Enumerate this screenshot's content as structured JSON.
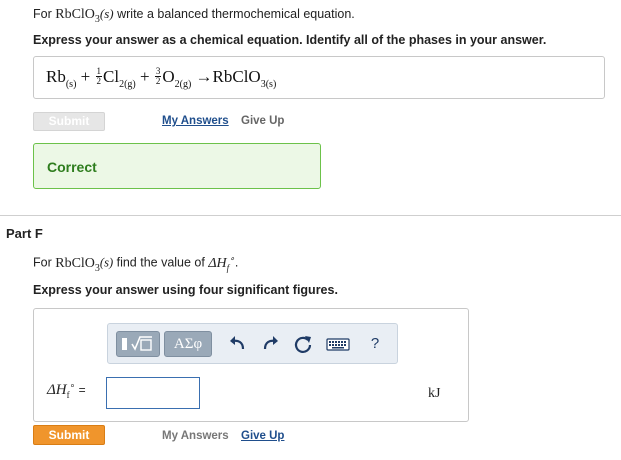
{
  "part_e": {
    "question_prefix": "For ",
    "compound": "RbClO",
    "compound_sub": "3",
    "phase": "(s)",
    "question_suffix": " write a balanced thermochemical equation.",
    "instructions": "Express your answer as a chemical equation. Identify all of the phases in your answer.",
    "equation": {
      "t1": "Rb",
      "t1_sub": "(s)",
      "plus1": " + ",
      "f1_num": "1",
      "f1_den": "2",
      "t2": "Cl",
      "t2_sub": "2(g)",
      "plus2": " + ",
      "f2_num": "3",
      "f2_den": "2",
      "t3": "O",
      "t3_sub": "2(g)",
      "arrow": " →",
      "t4": "RbClO",
      "t4_sub": "3(s)"
    },
    "submit_label": "Submit",
    "my_answers_label": "My Answers",
    "give_up_label": "Give Up",
    "feedback": "Correct"
  },
  "part_f": {
    "title": "Part F",
    "question_prefix": "For ",
    "compound": "RbClO",
    "compound_sub": "3",
    "phase": "(s)",
    "question_mid": " find the value of ",
    "delta_h": "ΔH",
    "delta_h_sub": "f",
    "delta_h_sup": "∘",
    "question_end": ".",
    "instructions": "Express your answer using four significant figures.",
    "toolbar": {
      "greek_label": "ΑΣφ",
      "help_label": "?"
    },
    "answer_label_eq": " =",
    "answer_value": "",
    "unit": "kJ",
    "submit_label": "Submit",
    "my_answers_label": "My Answers",
    "give_up_label": "Give Up"
  },
  "colors": {
    "accent": "#f0952c",
    "link": "#1f4e8c",
    "correct_bg": "#ecf8e6",
    "correct_border": "#6cc24a"
  },
  "icons": [
    "templates-icon",
    "undo-icon",
    "redo-icon",
    "reset-icon",
    "keyboard-icon",
    "help-icon"
  ]
}
